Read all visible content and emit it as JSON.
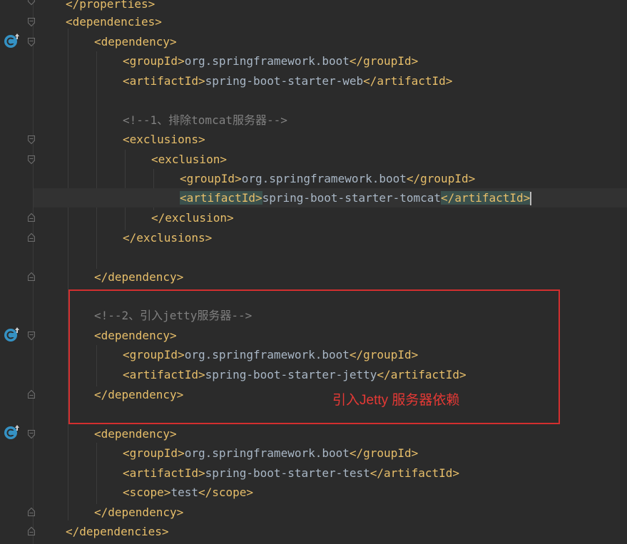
{
  "editor": {
    "lines": {
      "l1": {
        "open": "</",
        "name": "properties",
        "close": ">"
      },
      "l2": {
        "open": "<",
        "name": "dependencies",
        "close": ">"
      },
      "l3": {
        "open": "<",
        "name": "dependency",
        "close": ">"
      },
      "l4": {
        "tag_open": "<groupId>",
        "value": "org.springframework.boot",
        "tag_close": "</groupId>"
      },
      "l5": {
        "tag_open": "<artifactId>",
        "value": "spring-boot-starter-web",
        "tag_close": "</artifactId>"
      },
      "l7": {
        "comment": "<!--1、排除tomcat服务器-->"
      },
      "l8": {
        "tag": "<exclusions>"
      },
      "l9": {
        "tag": "<exclusion>"
      },
      "l10": {
        "tag_open": "<groupId>",
        "value": "org.springframework.boot",
        "tag_close": "</groupId>"
      },
      "l11": {
        "tag_open": "<artifactId>",
        "value": "spring-boot-starter-tomcat",
        "tag_close": "</artifactId>"
      },
      "l12": {
        "tag": "</exclusion>"
      },
      "l13": {
        "tag": "</exclusions>"
      },
      "l15": {
        "tag": "</dependency>"
      },
      "l17": {
        "comment": "<!--2、引入jetty服务器-->"
      },
      "l18": {
        "tag": "<dependency>"
      },
      "l19": {
        "tag_open": "<groupId>",
        "value": "org.springframework.boot",
        "tag_close": "</groupId>"
      },
      "l20": {
        "tag_open": "<artifactId>",
        "value": "spring-boot-starter-jetty",
        "tag_close": "</artifactId>"
      },
      "l21": {
        "tag": "</dependency>"
      },
      "l23": {
        "tag": "<dependency>"
      },
      "l24": {
        "tag_open": "<groupId>",
        "value": "org.springframework.boot",
        "tag_close": "</groupId>"
      },
      "l25": {
        "tag_open": "<artifactId>",
        "value": "spring-boot-starter-test",
        "tag_close": "</artifactId>"
      },
      "l26": {
        "tag_open": "<scope>",
        "value": "test",
        "tag_close": "</scope>"
      },
      "l27": {
        "tag": "</dependency>"
      },
      "l28": {
        "tag": "</dependencies>"
      }
    }
  },
  "annotation": {
    "label": "引入Jetty 服务器依赖",
    "color": "#e53935"
  },
  "colors": {
    "background": "#2b2b2b",
    "tag": "#e8bf6a",
    "text": "#a9b7c6",
    "comment": "#808080",
    "tag_match_highlight": "#3b514d",
    "current_line": "#323232"
  },
  "icons": {
    "gutter_dependency": "maven-dependency-icon",
    "fold": "fold-marker-icon"
  }
}
